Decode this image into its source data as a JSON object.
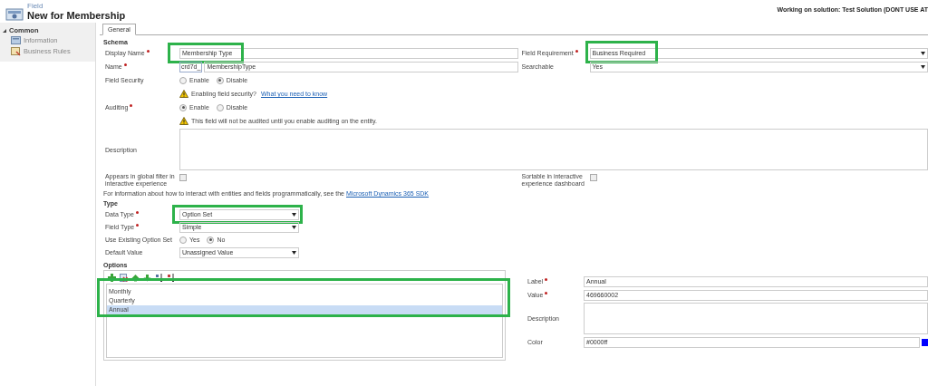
{
  "header": {
    "entity": "Field",
    "title": "New for Membership",
    "solution": "Working on solution: Test Solution (DONT USE AT"
  },
  "sidebar": {
    "section": "Common",
    "expanded": true,
    "items": [
      {
        "label": "Information",
        "kind": "info"
      },
      {
        "label": "Business Rules",
        "kind": "rules"
      }
    ]
  },
  "tabs": [
    {
      "label": "General",
      "selected": true
    }
  ],
  "schema": {
    "heading": "Schema",
    "rows": [
      {
        "left": {
          "kind": "text",
          "label": "Display Name",
          "required": true,
          "value": "Membership Type",
          "highlighted": true
        },
        "right": {
          "kind": "select",
          "label": "Field Requirement",
          "required": true,
          "value": "Business Required",
          "highlighted": true
        }
      },
      {
        "left": {
          "kind": "prefixed",
          "label": "Name",
          "required": true,
          "prefix": "crd7d_",
          "value": "MembershipType"
        },
        "right": {
          "kind": "select",
          "label": "Searchable",
          "required": false,
          "value": "Yes"
        }
      },
      {
        "left": {
          "kind": "radio",
          "label": "Field Security",
          "required": false,
          "options": [
            {
              "label": "Enable",
              "selected": false
            },
            {
              "label": "Disable",
              "selected": true
            }
          ]
        }
      },
      {
        "left": {
          "kind": "note",
          "text": "Enabling field security?",
          "link": "What you need to know"
        }
      },
      {
        "left": {
          "kind": "radio",
          "label": "Auditing",
          "required": true,
          "options": [
            {
              "label": "Enable",
              "selected": true
            },
            {
              "label": "Disable",
              "selected": false
            }
          ]
        }
      },
      {
        "left": {
          "kind": "note",
          "text": "This field will not be audited until you enable auditing on the entity."
        }
      },
      {
        "left": {
          "kind": "textarea",
          "label": "Description",
          "required": false
        }
      },
      {
        "left": {
          "kind": "checkbox",
          "label": "Appears in global filter in interactive experience",
          "checked": false
        },
        "right": {
          "kind": "checkbox",
          "label": "Sortable in interactive experience dashboard",
          "checked": false
        }
      }
    ],
    "info": {
      "text": "For information about how to interact with entities and fields programmatically, see the",
      "link": "Microsoft Dynamics 365 SDK"
    }
  },
  "type": {
    "heading": "Type",
    "rows": [
      {
        "left": {
          "kind": "select",
          "label": "Data Type",
          "required": true,
          "value": "Option Set",
          "highlighted": true
        }
      },
      {
        "left": {
          "kind": "select",
          "label": "Field Type",
          "required": true,
          "value": "Simple"
        }
      },
      {
        "left": {
          "kind": "radio",
          "label": "Use Existing Option Set",
          "required": false,
          "options": [
            {
              "label": "Yes",
              "selected": false
            },
            {
              "label": "No",
              "selected": true
            }
          ]
        }
      },
      {
        "left": {
          "kind": "select",
          "label": "Default Value",
          "required": false,
          "value": "Unassigned Value"
        }
      }
    ]
  },
  "options": {
    "heading": "Options",
    "highlighted": true,
    "toolbar": [
      {
        "kind": "add"
      },
      {
        "kind": "delete"
      },
      {
        "kind": "up"
      },
      {
        "kind": "down"
      },
      {
        "kind": "sort-asc"
      },
      {
        "kind": "sort-desc"
      }
    ],
    "items": [
      {
        "label": "Monthly",
        "selected": false
      },
      {
        "label": "Quarterly",
        "selected": false
      },
      {
        "label": "Annual",
        "selected": true
      }
    ],
    "detail": [
      {
        "kind": "text",
        "label": "Label",
        "required": true,
        "value": "Annual"
      },
      {
        "kind": "text",
        "label": "Value",
        "required": true,
        "value": "469660002"
      },
      {
        "kind": "textarea",
        "label": "Description",
        "required": false
      },
      {
        "kind": "color",
        "label": "Color",
        "required": false,
        "value": "#0000ff"
      }
    ]
  }
}
